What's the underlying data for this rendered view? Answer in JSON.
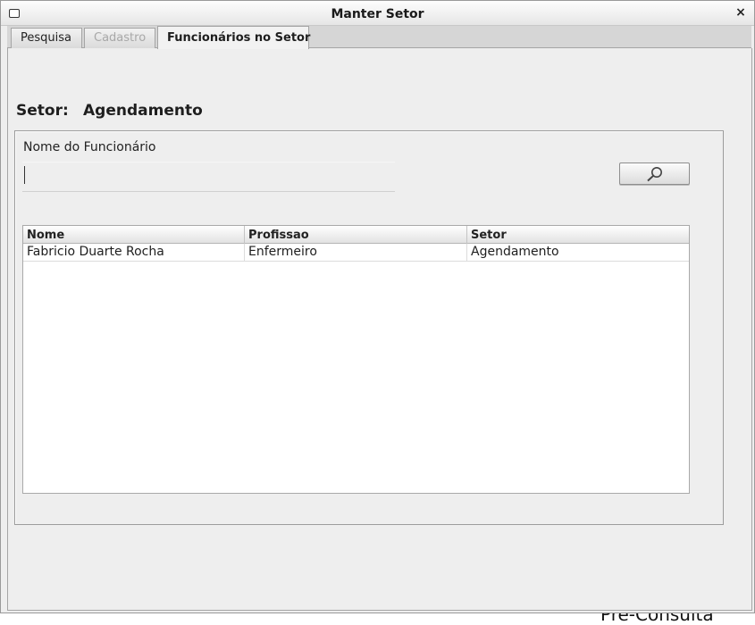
{
  "window": {
    "title": "Manter Setor",
    "close_symbol": "×"
  },
  "tabs": [
    {
      "label": "Pesquisa",
      "state": "normal"
    },
    {
      "label": "Cadastro",
      "state": "disabled"
    },
    {
      "label": "Funcionários no Setor",
      "state": "active"
    }
  ],
  "setor": {
    "label": "Setor:",
    "value": "Agendamento"
  },
  "search": {
    "label": "Nome do Funcionário",
    "value": "",
    "button_icon": "magnifier-icon"
  },
  "table": {
    "columns": [
      "Nome",
      "Profissao",
      "Setor"
    ],
    "rows": [
      [
        "Fabricio Duarte Rocha",
        "Enfermeiro",
        "Agendamento"
      ]
    ]
  },
  "background": {
    "partial_text": "Pré-Consulta"
  }
}
